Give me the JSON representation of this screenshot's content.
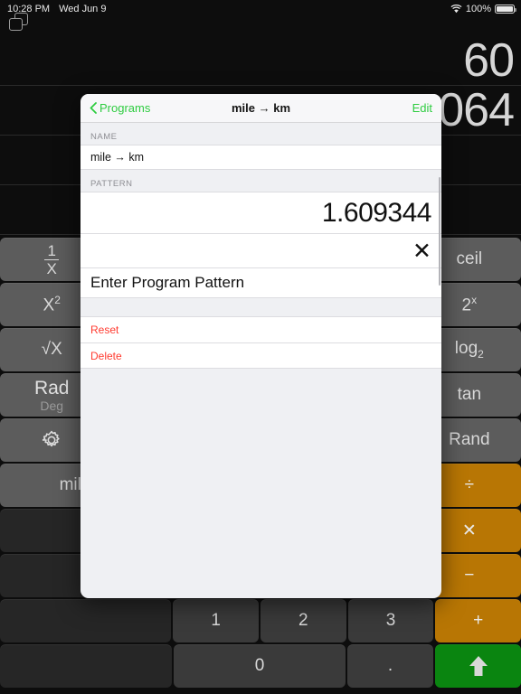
{
  "statusbar": {
    "time": "10:28 PM",
    "date": "Wed Jun 9",
    "battery_percent": "100%",
    "wifi_icon": "wifi-icon",
    "battery_icon": "battery-icon",
    "windows_icon": "windows-stack-icon"
  },
  "display": {
    "rows": [
      {
        "value": "60"
      },
      {
        "value": "064"
      },
      {
        "value": ""
      },
      {
        "value": ""
      }
    ]
  },
  "modal": {
    "nav": {
      "back_label": "Programs",
      "back_icon": "chevron-left-icon",
      "title": "mile → km",
      "edit_label": "Edit"
    },
    "sections": {
      "name_header": "NAME",
      "name_value": "mile → km",
      "pattern_header": "PATTERN",
      "pattern_value": "1.609344",
      "pattern_operator": "✕",
      "pattern_entry_placeholder": "Enter Program Pattern"
    },
    "actions": [
      {
        "label": "Reset",
        "name": "reset-action"
      },
      {
        "label": "Delete",
        "name": "delete-action"
      }
    ]
  },
  "keypad": {
    "rows": [
      {
        "keys": [
          {
            "label": "1/X",
            "name": "key-reciprocal",
            "style": "fn",
            "width": "w2",
            "glyph": "frac"
          },
          {
            "label": "",
            "name": "key-hidden-a",
            "style": "blank",
            "width": "w6",
            "glyph": "none"
          },
          {
            "label": "ceil",
            "name": "key-ceil",
            "style": "fn",
            "width": "w2",
            "glyph": "text"
          }
        ]
      },
      {
        "keys": [
          {
            "label": "X²",
            "name": "key-square",
            "style": "fn",
            "width": "w2",
            "glyph": "sup-x2"
          },
          {
            "label": "",
            "name": "key-hidden-b",
            "style": "blank",
            "width": "w6",
            "glyph": "none"
          },
          {
            "label": "2ˣ",
            "name": "key-two-pow-x",
            "style": "fn",
            "width": "w2",
            "glyph": "sup-2x"
          }
        ]
      },
      {
        "keys": [
          {
            "label": "√X",
            "name": "key-sqrt",
            "style": "fn",
            "width": "w2",
            "glyph": "text"
          },
          {
            "label": "",
            "name": "key-hidden-c",
            "style": "blank",
            "width": "w6",
            "glyph": "none"
          },
          {
            "label": "log₂",
            "name": "key-log2",
            "style": "fn",
            "width": "w2",
            "glyph": "sub-log2"
          }
        ]
      },
      {
        "keys": [
          {
            "label": "Rad",
            "sublabel": "Deg",
            "name": "key-rad-deg",
            "style": "fn",
            "width": "w2",
            "glyph": "raddeg"
          },
          {
            "label": "",
            "name": "key-hidden-d",
            "style": "blank",
            "width": "w6",
            "glyph": "none"
          },
          {
            "label": "tan",
            "name": "key-tan",
            "style": "fn",
            "width": "w2",
            "glyph": "text"
          }
        ]
      },
      {
        "keys": [
          {
            "label": "gear",
            "name": "key-settings",
            "style": "fn",
            "width": "w2",
            "glyph": "gear"
          },
          {
            "label": "",
            "name": "key-hidden-e",
            "style": "blank",
            "width": "w6",
            "glyph": "none"
          },
          {
            "label": "Rand",
            "name": "key-rand",
            "style": "fn",
            "width": "w2",
            "glyph": "text"
          }
        ]
      },
      {
        "keys": [
          {
            "label": "mile",
            "name": "key-mile",
            "style": "fn",
            "width": "w2",
            "glyph": "text-right"
          },
          {
            "label": "",
            "name": "key-hidden-f",
            "style": "blank",
            "width": "w6",
            "glyph": "none"
          },
          {
            "label": "÷",
            "name": "key-divide",
            "style": "op",
            "width": "w2",
            "glyph": "text"
          }
        ]
      },
      {
        "keys": [
          {
            "label": "",
            "name": "key-hidden-g",
            "style": "dark",
            "width": "w2",
            "glyph": "none"
          },
          {
            "label": "",
            "name": "key-hidden-h",
            "style": "blank",
            "width": "w6",
            "glyph": "none"
          },
          {
            "label": "✕",
            "name": "key-multiply",
            "style": "op",
            "width": "w2",
            "glyph": "text"
          }
        ]
      },
      {
        "keys": [
          {
            "label": "",
            "name": "key-hidden-i",
            "style": "dark",
            "width": "w2",
            "glyph": "none"
          },
          {
            "label": "",
            "name": "key-hidden-j",
            "style": "blank",
            "width": "w6",
            "glyph": "none"
          },
          {
            "label": "−",
            "name": "key-minus",
            "style": "op",
            "width": "w2",
            "glyph": "text"
          }
        ]
      },
      {
        "keys": [
          {
            "label": "",
            "name": "key-hidden-k",
            "style": "dark",
            "width": "w4",
            "glyph": "none"
          },
          {
            "label": "1",
            "name": "key-1",
            "style": "num",
            "width": "w2",
            "glyph": "text"
          },
          {
            "label": "2",
            "name": "key-2",
            "style": "num",
            "width": "w2",
            "glyph": "text"
          },
          {
            "label": "3",
            "name": "key-3",
            "style": "num",
            "width": "w2",
            "glyph": "text"
          },
          {
            "label": "+",
            "name": "key-plus",
            "style": "op",
            "width": "w2",
            "glyph": "text"
          }
        ]
      },
      {
        "keys": [
          {
            "label": "",
            "name": "key-hidden-l",
            "style": "dark",
            "width": "w4",
            "glyph": "none"
          },
          {
            "label": "0",
            "name": "key-0",
            "style": "num",
            "width": "w4",
            "glyph": "text"
          },
          {
            "label": ".",
            "name": "key-decimal",
            "style": "num",
            "width": "w2",
            "glyph": "text"
          },
          {
            "label": "⬆",
            "name": "key-enter",
            "style": "enter",
            "width": "w2",
            "glyph": "arrow-up"
          }
        ]
      }
    ]
  },
  "colors": {
    "accent_green": "#2ecc40",
    "operator_orange": "#b87604",
    "enter_green": "#0a8510",
    "destructive_red": "#ff3b30",
    "key_gray": "#5c5c5c",
    "background": "#0d0d0d"
  }
}
